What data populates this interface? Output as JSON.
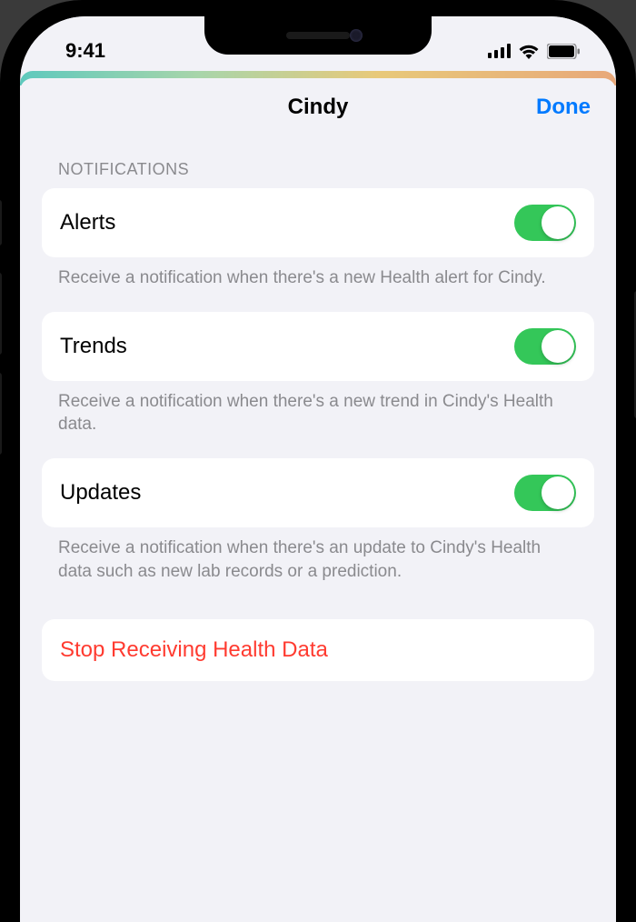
{
  "statusBar": {
    "time": "9:41"
  },
  "nav": {
    "title": "Cindy",
    "done": "Done"
  },
  "section": {
    "header": "NOTIFICATIONS"
  },
  "toggles": {
    "alerts": {
      "label": "Alerts",
      "footer": "Receive a notification when there's a new Health alert for Cindy."
    },
    "trends": {
      "label": "Trends",
      "footer": "Receive a notification when there's a new trend in Cindy's Health data."
    },
    "updates": {
      "label": "Updates",
      "footer": "Receive a notification when there's an update to Cindy's Health data such as new lab records or a prediction."
    }
  },
  "action": {
    "stop": "Stop Receiving Health Data"
  },
  "colors": {
    "toggleOn": "#34c759",
    "link": "#007aff",
    "destructive": "#ff3b30",
    "background": "#f2f2f7"
  }
}
